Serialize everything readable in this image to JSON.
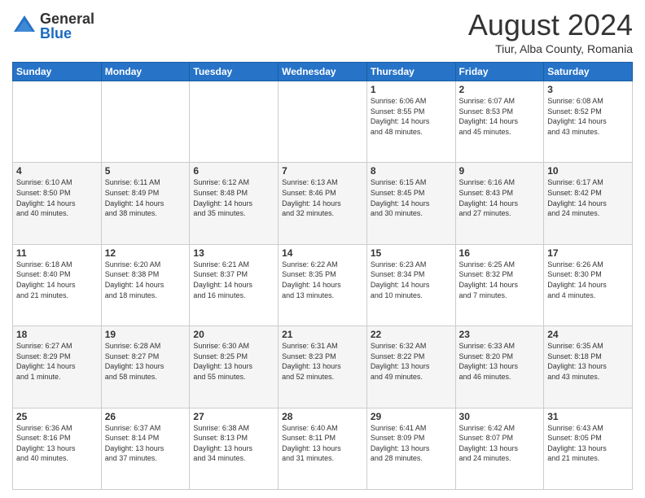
{
  "logo": {
    "general": "General",
    "blue": "Blue"
  },
  "title": "August 2024",
  "location": "Tiur, Alba County, Romania",
  "days_header": [
    "Sunday",
    "Monday",
    "Tuesday",
    "Wednesday",
    "Thursday",
    "Friday",
    "Saturday"
  ],
  "weeks": [
    [
      {
        "num": "",
        "info": ""
      },
      {
        "num": "",
        "info": ""
      },
      {
        "num": "",
        "info": ""
      },
      {
        "num": "",
        "info": ""
      },
      {
        "num": "1",
        "info": "Sunrise: 6:06 AM\nSunset: 8:55 PM\nDaylight: 14 hours\nand 48 minutes."
      },
      {
        "num": "2",
        "info": "Sunrise: 6:07 AM\nSunset: 8:53 PM\nDaylight: 14 hours\nand 45 minutes."
      },
      {
        "num": "3",
        "info": "Sunrise: 6:08 AM\nSunset: 8:52 PM\nDaylight: 14 hours\nand 43 minutes."
      }
    ],
    [
      {
        "num": "4",
        "info": "Sunrise: 6:10 AM\nSunset: 8:50 PM\nDaylight: 14 hours\nand 40 minutes."
      },
      {
        "num": "5",
        "info": "Sunrise: 6:11 AM\nSunset: 8:49 PM\nDaylight: 14 hours\nand 38 minutes."
      },
      {
        "num": "6",
        "info": "Sunrise: 6:12 AM\nSunset: 8:48 PM\nDaylight: 14 hours\nand 35 minutes."
      },
      {
        "num": "7",
        "info": "Sunrise: 6:13 AM\nSunset: 8:46 PM\nDaylight: 14 hours\nand 32 minutes."
      },
      {
        "num": "8",
        "info": "Sunrise: 6:15 AM\nSunset: 8:45 PM\nDaylight: 14 hours\nand 30 minutes."
      },
      {
        "num": "9",
        "info": "Sunrise: 6:16 AM\nSunset: 8:43 PM\nDaylight: 14 hours\nand 27 minutes."
      },
      {
        "num": "10",
        "info": "Sunrise: 6:17 AM\nSunset: 8:42 PM\nDaylight: 14 hours\nand 24 minutes."
      }
    ],
    [
      {
        "num": "11",
        "info": "Sunrise: 6:18 AM\nSunset: 8:40 PM\nDaylight: 14 hours\nand 21 minutes."
      },
      {
        "num": "12",
        "info": "Sunrise: 6:20 AM\nSunset: 8:38 PM\nDaylight: 14 hours\nand 18 minutes."
      },
      {
        "num": "13",
        "info": "Sunrise: 6:21 AM\nSunset: 8:37 PM\nDaylight: 14 hours\nand 16 minutes."
      },
      {
        "num": "14",
        "info": "Sunrise: 6:22 AM\nSunset: 8:35 PM\nDaylight: 14 hours\nand 13 minutes."
      },
      {
        "num": "15",
        "info": "Sunrise: 6:23 AM\nSunset: 8:34 PM\nDaylight: 14 hours\nand 10 minutes."
      },
      {
        "num": "16",
        "info": "Sunrise: 6:25 AM\nSunset: 8:32 PM\nDaylight: 14 hours\nand 7 minutes."
      },
      {
        "num": "17",
        "info": "Sunrise: 6:26 AM\nSunset: 8:30 PM\nDaylight: 14 hours\nand 4 minutes."
      }
    ],
    [
      {
        "num": "18",
        "info": "Sunrise: 6:27 AM\nSunset: 8:29 PM\nDaylight: 14 hours\nand 1 minute."
      },
      {
        "num": "19",
        "info": "Sunrise: 6:28 AM\nSunset: 8:27 PM\nDaylight: 13 hours\nand 58 minutes."
      },
      {
        "num": "20",
        "info": "Sunrise: 6:30 AM\nSunset: 8:25 PM\nDaylight: 13 hours\nand 55 minutes."
      },
      {
        "num": "21",
        "info": "Sunrise: 6:31 AM\nSunset: 8:23 PM\nDaylight: 13 hours\nand 52 minutes."
      },
      {
        "num": "22",
        "info": "Sunrise: 6:32 AM\nSunset: 8:22 PM\nDaylight: 13 hours\nand 49 minutes."
      },
      {
        "num": "23",
        "info": "Sunrise: 6:33 AM\nSunset: 8:20 PM\nDaylight: 13 hours\nand 46 minutes."
      },
      {
        "num": "24",
        "info": "Sunrise: 6:35 AM\nSunset: 8:18 PM\nDaylight: 13 hours\nand 43 minutes."
      }
    ],
    [
      {
        "num": "25",
        "info": "Sunrise: 6:36 AM\nSunset: 8:16 PM\nDaylight: 13 hours\nand 40 minutes."
      },
      {
        "num": "26",
        "info": "Sunrise: 6:37 AM\nSunset: 8:14 PM\nDaylight: 13 hours\nand 37 minutes."
      },
      {
        "num": "27",
        "info": "Sunrise: 6:38 AM\nSunset: 8:13 PM\nDaylight: 13 hours\nand 34 minutes."
      },
      {
        "num": "28",
        "info": "Sunrise: 6:40 AM\nSunset: 8:11 PM\nDaylight: 13 hours\nand 31 minutes."
      },
      {
        "num": "29",
        "info": "Sunrise: 6:41 AM\nSunset: 8:09 PM\nDaylight: 13 hours\nand 28 minutes."
      },
      {
        "num": "30",
        "info": "Sunrise: 6:42 AM\nSunset: 8:07 PM\nDaylight: 13 hours\nand 24 minutes."
      },
      {
        "num": "31",
        "info": "Sunrise: 6:43 AM\nSunset: 8:05 PM\nDaylight: 13 hours\nand 21 minutes."
      }
    ]
  ]
}
